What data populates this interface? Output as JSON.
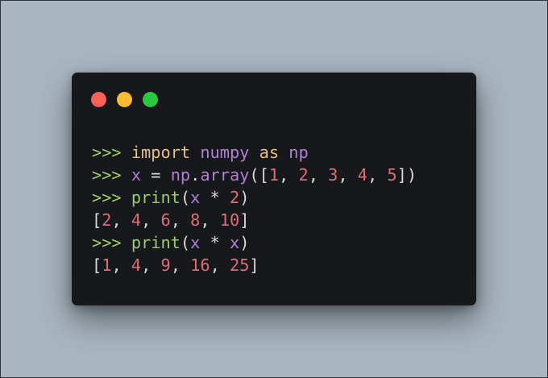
{
  "window": {
    "background": "#17181b",
    "traffic_lights": [
      {
        "name": "close",
        "color": "#fe5f57"
      },
      {
        "name": "minimize",
        "color": "#febc2e"
      },
      {
        "name": "zoom",
        "color": "#28c840"
      }
    ]
  },
  "colors": {
    "prompt": "#9ccc65",
    "keyword": "#e5c07b",
    "identifier": "#b07fd6",
    "builtin": "#9ccc65",
    "number": "#e06c75",
    "punct": "#d7d7d7",
    "output": "#d7d7d7"
  },
  "code": {
    "lines": [
      {
        "tokens": [
          {
            "t": ">>> ",
            "k": "prompt"
          },
          {
            "t": "import",
            "k": "keyword"
          },
          {
            "t": " ",
            "k": "punct"
          },
          {
            "t": "numpy",
            "k": "identifier"
          },
          {
            "t": " ",
            "k": "punct"
          },
          {
            "t": "as",
            "k": "keyword"
          },
          {
            "t": " ",
            "k": "punct"
          },
          {
            "t": "np",
            "k": "identifier"
          }
        ]
      },
      {
        "tokens": [
          {
            "t": ">>> ",
            "k": "prompt"
          },
          {
            "t": "x",
            "k": "identifier"
          },
          {
            "t": " = ",
            "k": "punct"
          },
          {
            "t": "np",
            "k": "identifier"
          },
          {
            "t": ".",
            "k": "punct"
          },
          {
            "t": "array",
            "k": "identifier"
          },
          {
            "t": "([",
            "k": "punct"
          },
          {
            "t": "1",
            "k": "number"
          },
          {
            "t": ", ",
            "k": "punct"
          },
          {
            "t": "2",
            "k": "number"
          },
          {
            "t": ", ",
            "k": "punct"
          },
          {
            "t": "3",
            "k": "number"
          },
          {
            "t": ", ",
            "k": "punct"
          },
          {
            "t": "4",
            "k": "number"
          },
          {
            "t": ", ",
            "k": "punct"
          },
          {
            "t": "5",
            "k": "number"
          },
          {
            "t": "])",
            "k": "punct"
          }
        ]
      },
      {
        "tokens": [
          {
            "t": ">>> ",
            "k": "prompt"
          },
          {
            "t": "print",
            "k": "builtin"
          },
          {
            "t": "(",
            "k": "punct"
          },
          {
            "t": "x",
            "k": "identifier"
          },
          {
            "t": " * ",
            "k": "punct"
          },
          {
            "t": "2",
            "k": "number"
          },
          {
            "t": ")",
            "k": "punct"
          }
        ]
      },
      {
        "tokens": [
          {
            "t": "[",
            "k": "output"
          },
          {
            "t": "2",
            "k": "number"
          },
          {
            "t": ", ",
            "k": "output"
          },
          {
            "t": "4",
            "k": "number"
          },
          {
            "t": ", ",
            "k": "output"
          },
          {
            "t": "6",
            "k": "number"
          },
          {
            "t": ", ",
            "k": "output"
          },
          {
            "t": "8",
            "k": "number"
          },
          {
            "t": ", ",
            "k": "output"
          },
          {
            "t": "10",
            "k": "number"
          },
          {
            "t": "]",
            "k": "output"
          }
        ]
      },
      {
        "tokens": [
          {
            "t": ">>> ",
            "k": "prompt"
          },
          {
            "t": "print",
            "k": "builtin"
          },
          {
            "t": "(",
            "k": "punct"
          },
          {
            "t": "x",
            "k": "identifier"
          },
          {
            "t": " * ",
            "k": "punct"
          },
          {
            "t": "x",
            "k": "identifier"
          },
          {
            "t": ")",
            "k": "punct"
          }
        ]
      },
      {
        "tokens": [
          {
            "t": "[",
            "k": "output"
          },
          {
            "t": "1",
            "k": "number"
          },
          {
            "t": ", ",
            "k": "output"
          },
          {
            "t": "4",
            "k": "number"
          },
          {
            "t": ", ",
            "k": "output"
          },
          {
            "t": "9",
            "k": "number"
          },
          {
            "t": ", ",
            "k": "output"
          },
          {
            "t": "16",
            "k": "number"
          },
          {
            "t": ", ",
            "k": "output"
          },
          {
            "t": "25",
            "k": "number"
          },
          {
            "t": "]",
            "k": "output"
          }
        ]
      }
    ]
  }
}
